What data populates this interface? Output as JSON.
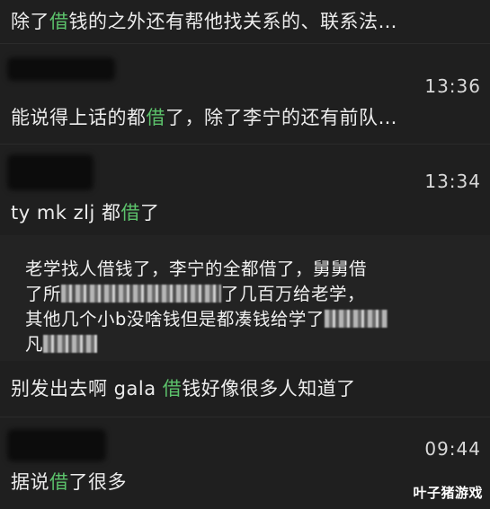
{
  "messages": [
    {
      "before": "除了",
      "highlight": "借",
      "after": "钱的之外还有帮他找关系的、联系法…",
      "time": ""
    },
    {
      "before": "能说得上话的都",
      "highlight": "借",
      "after": "了，除了李宁的还有前队…",
      "time": "13:36"
    },
    {
      "before": "ty mk zlj 都",
      "highlight": "借",
      "after": "了",
      "time": "13:34"
    },
    {
      "before": "别发出去啊 gala ",
      "highlight": "借",
      "after": "钱好像很多人知道了",
      "time": ""
    },
    {
      "before": "据说",
      "highlight": "借",
      "after": "了很多",
      "time": "09:44"
    }
  ],
  "quote": {
    "line1": "老学找人借钱了，李宁的全都借了，舅舅借",
    "line2_a": "了所",
    "line2_b": "了几百万给老学，",
    "line3": "其他几个小b没啥钱但是都凑钱给学了",
    "line4": "凡"
  },
  "watermark": "叶子猪游戏"
}
